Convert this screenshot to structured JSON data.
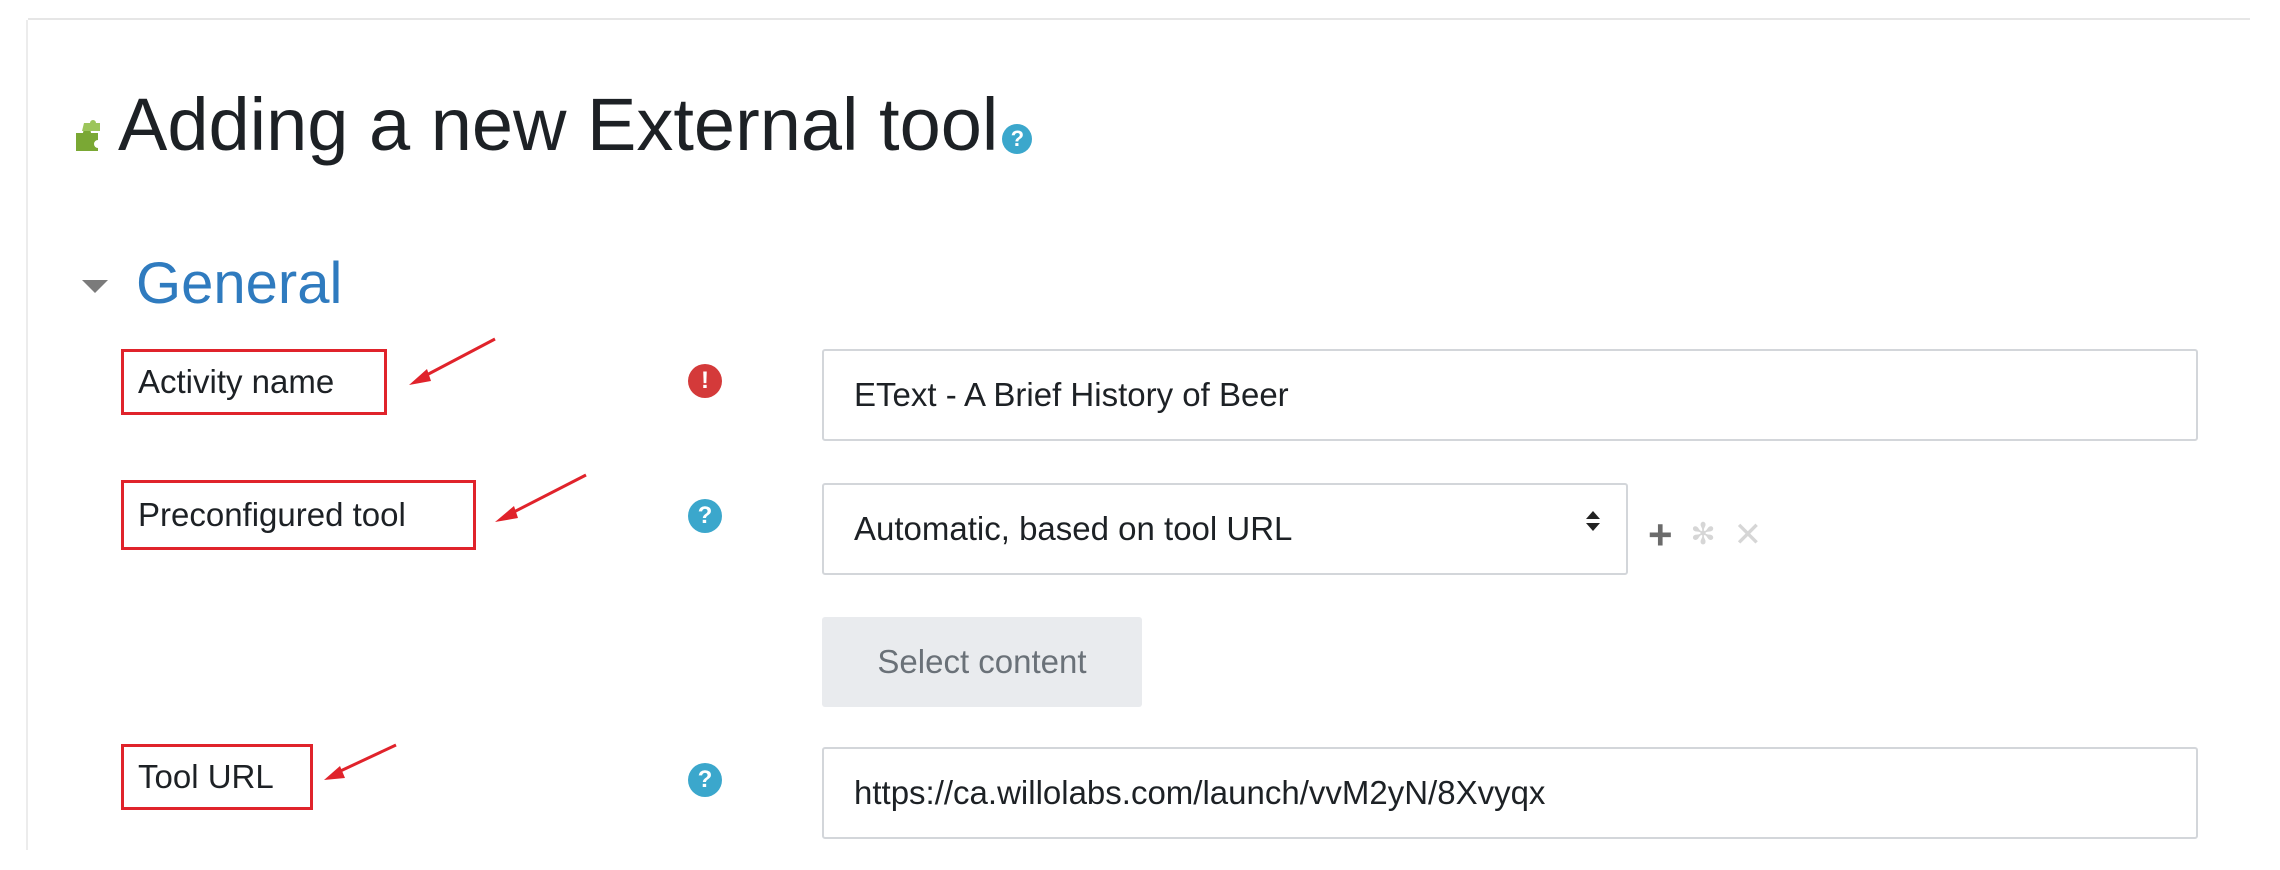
{
  "page": {
    "title": "Adding a new External tool",
    "title_icon": "puzzle-piece-icon",
    "help_icon": "help-icon"
  },
  "section": {
    "title": "General",
    "toggle_icon": "caret-down-icon"
  },
  "fields": {
    "activity_name": {
      "label": "Activity name",
      "status_icon": "required-icon",
      "value": "EText - A Brief History of Beer"
    },
    "preconfigured_tool": {
      "label": "Preconfigured tool",
      "help_icon": "help-icon",
      "selected": "Automatic, based on tool URL",
      "actions": [
        "add-icon",
        "settings-icon",
        "delete-icon"
      ]
    },
    "select_content": {
      "button_label": "Select content"
    },
    "tool_url": {
      "label": "Tool URL",
      "help_icon": "help-icon",
      "value": "https://ca.willolabs.com/launch/vvM2yN/8Xvyqx"
    }
  },
  "colors": {
    "section_title": "#2f7bbf",
    "help_badge": "#3ba7cc",
    "error_badge": "#d43a3a",
    "annotation_red": "#e0232b",
    "button_bg": "#e9ebee"
  }
}
